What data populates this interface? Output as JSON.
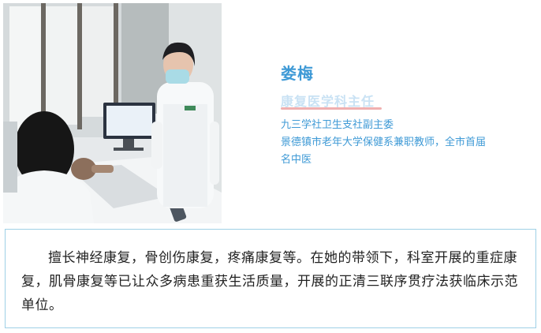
{
  "profile": {
    "name": "娄梅",
    "title": "康复医学科主任",
    "roles": [
      "九三学社卫生支社副主委",
      "景德镇市老年大学保健系兼职教师，全市首届",
      "名中医"
    ]
  },
  "description": "擅长神经康复，骨创伤康复，疼痛康复等。在她的带领下，科室开展的重症康复，肌骨康复等已让众多病患重获生活质量，开展的正清三联序贯疗法获临床示范单位。",
  "colors": {
    "accent_blue": "#3f9ad6",
    "title_light_blue": "#c9e2f4",
    "underline_pink": "#f0b0b0",
    "box_border": "#9fd0e6"
  }
}
